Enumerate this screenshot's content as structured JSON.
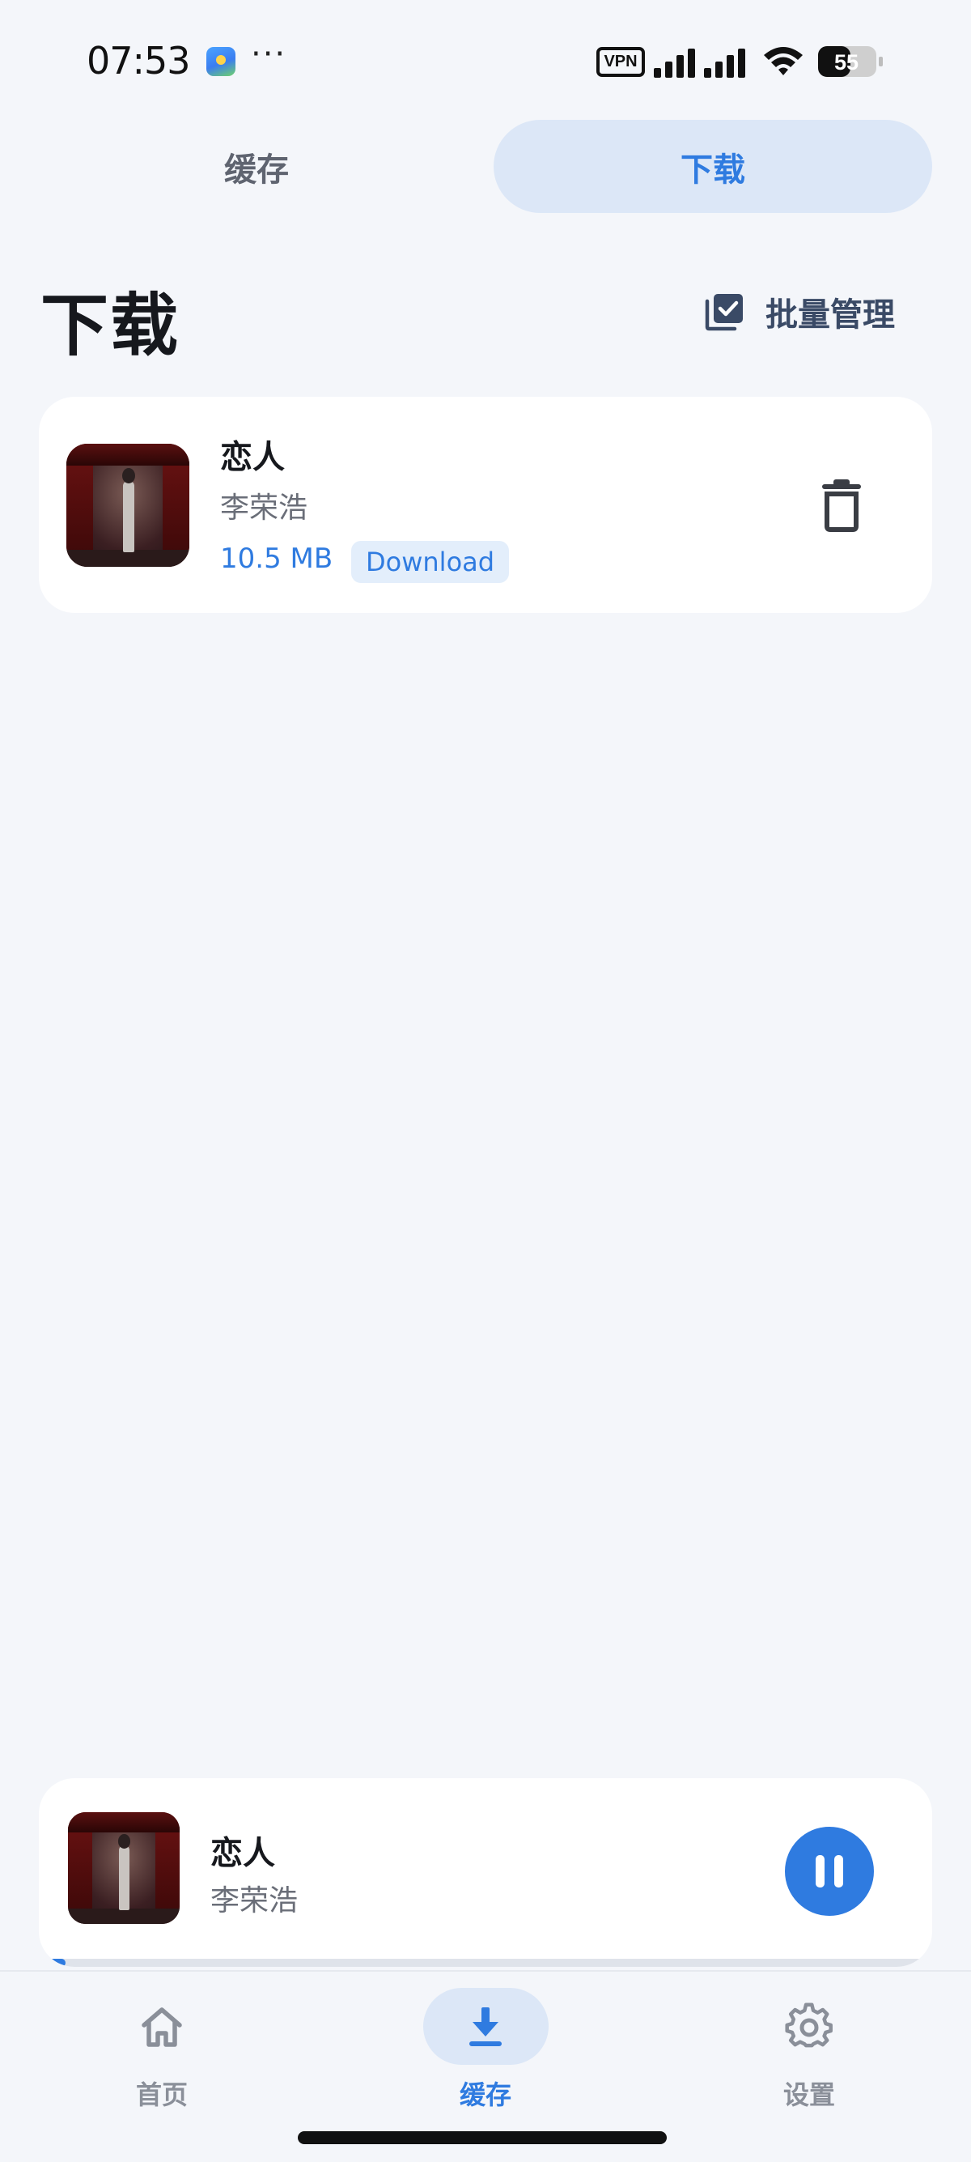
{
  "status_bar": {
    "time": "07:53",
    "dots": "···",
    "vpn_label": "VPN",
    "battery_level": "55"
  },
  "top_tabs": [
    {
      "label": "缓存",
      "active": false
    },
    {
      "label": "下载",
      "active": true
    }
  ],
  "header": {
    "title": "下载",
    "batch_manage_label": "批量管理"
  },
  "downloads": [
    {
      "title": "恋人",
      "artist": "李荣浩",
      "size": "10.5 MB",
      "status": "Download"
    }
  ],
  "mini_player": {
    "title": "恋人",
    "artist": "李荣浩",
    "state": "playing",
    "progress": 0.03
  },
  "bottom_nav": {
    "home_label": "首页",
    "cache_label": "缓存",
    "settings_label": "设置",
    "active": "缓存"
  },
  "colors": {
    "accent": "#2f7be0",
    "background": "#f4f6fa",
    "active_tab_bg": "#dce7f7"
  }
}
